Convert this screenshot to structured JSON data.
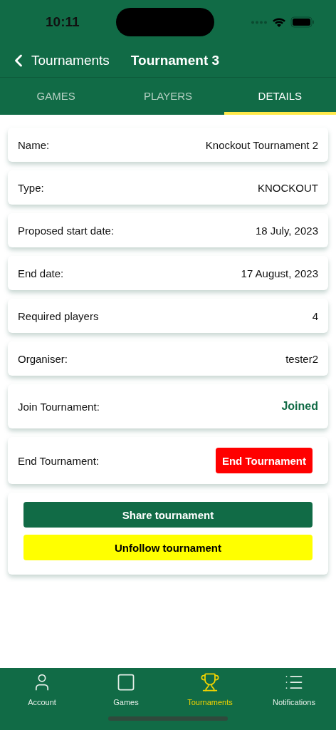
{
  "status_bar": {
    "time": "10:11"
  },
  "nav": {
    "back": "Tournaments",
    "title": "Tournament 3"
  },
  "tabs": [
    {
      "label": "GAMES",
      "selected": false
    },
    {
      "label": "PLAYERS",
      "selected": false
    },
    {
      "label": "DETAILS",
      "selected": true
    }
  ],
  "details": [
    {
      "kind": "text",
      "label": "Name:",
      "value": "Knockout Tournament 2"
    },
    {
      "kind": "text",
      "label": "Type:",
      "value": "KNOCKOUT"
    },
    {
      "kind": "text",
      "label": "Proposed start date:",
      "value": "18 July, 2023"
    },
    {
      "kind": "text",
      "label": "End date:",
      "value": "17 August, 2023"
    },
    {
      "kind": "text",
      "label": "Required players",
      "value": "4"
    },
    {
      "kind": "text",
      "label": "Organiser:",
      "value": "tester2"
    },
    {
      "kind": "status",
      "label": "Join Tournament:",
      "value": "Joined"
    },
    {
      "kind": "button",
      "label": "End Tournament:",
      "value": "End Tournament"
    }
  ],
  "actions": [
    {
      "label": "Share tournament",
      "kind": "primary"
    },
    {
      "label": "Unfollow tournament",
      "kind": "warning"
    }
  ],
  "bottom_tabs": [
    {
      "label": "Account",
      "selected": false
    },
    {
      "label": "Games",
      "selected": false
    },
    {
      "label": "Tournaments",
      "selected": true
    },
    {
      "label": "Notifications",
      "selected": false
    }
  ]
}
